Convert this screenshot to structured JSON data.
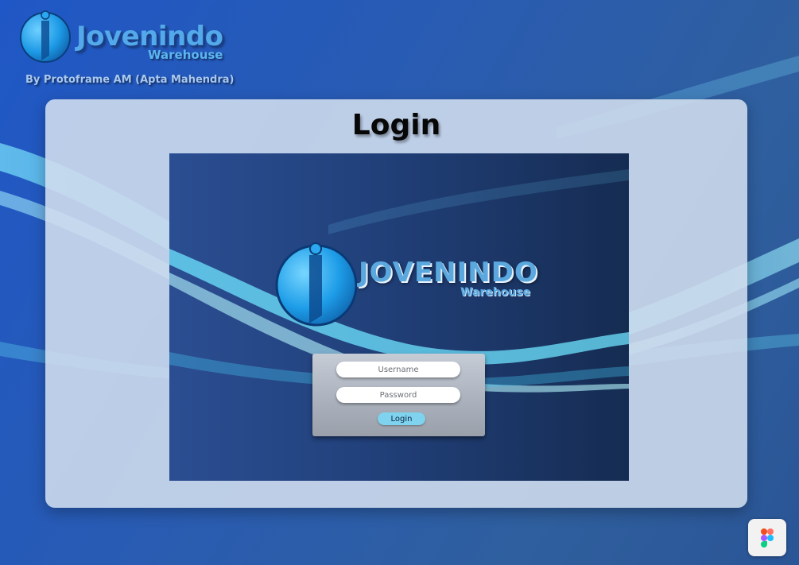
{
  "header": {
    "brand_title": "Jovenindo",
    "brand_subtitle": "Warehouse",
    "credit": "By Protoframe AM (Apta Mahendra)"
  },
  "panel": {
    "title": "Login",
    "preview": {
      "logo_title": "JOVENINDO",
      "logo_subtitle": "Warehouse",
      "form": {
        "username_placeholder": "Username",
        "password_placeholder": "Password",
        "login_label": "Login"
      }
    }
  },
  "icons": {
    "brand_logo": "jovenindo-logo-icon",
    "figma": "figma-icon"
  },
  "colors": {
    "background": "#2a5cb0",
    "panel": "#d2deee",
    "accent": "#53a9ea",
    "login_button": "#7fd3ef"
  }
}
